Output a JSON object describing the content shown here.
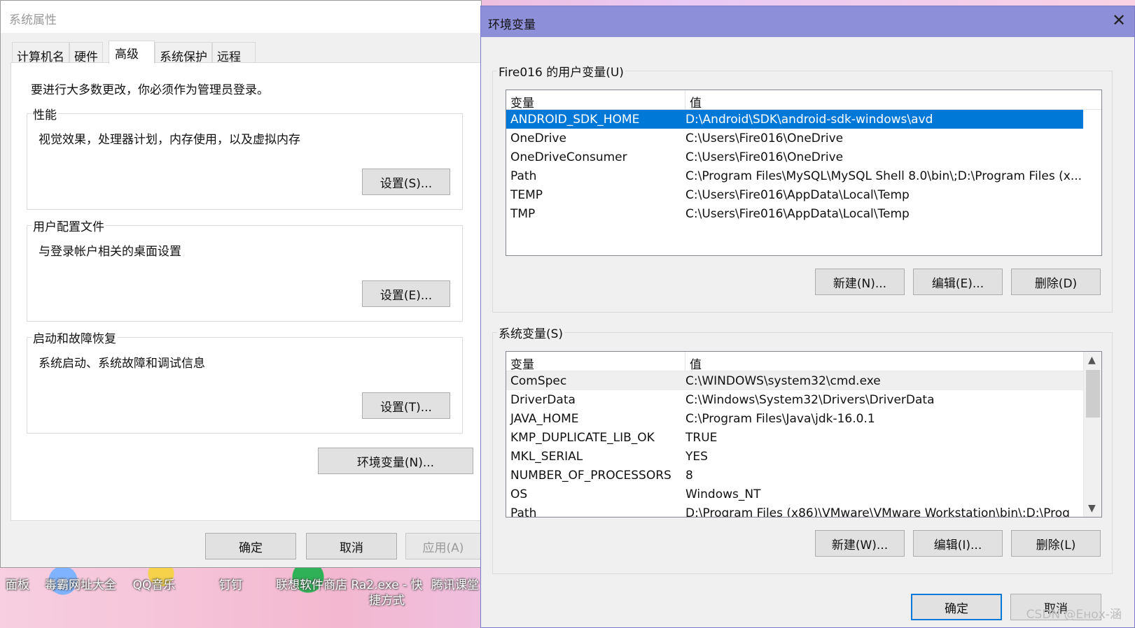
{
  "desktop": {
    "icons": [
      "面板",
      "毒霸网址大全",
      "QQ音乐",
      "钉钉",
      "联想软件商店",
      "Ra2.exe - 快\n捷方式",
      "腾讯课堂"
    ]
  },
  "sysprops": {
    "title": "系统属性",
    "tabs": [
      "计算机名",
      "硬件",
      "高级",
      "系统保护",
      "远程"
    ],
    "active_tab": "高级",
    "admin_note": "要进行大多数更改，你必须作为管理员登录。",
    "performance": {
      "label": "性能",
      "desc": "视觉效果，处理器计划，内存使用，以及虚拟内存",
      "button": "设置(S)..."
    },
    "user_profile": {
      "label": "用户配置文件",
      "desc": "与登录帐户相关的桌面设置",
      "button": "设置(E)..."
    },
    "startup": {
      "label": "启动和故障恢复",
      "desc": "系统启动、系统故障和调试信息",
      "button": "设置(T)..."
    },
    "env_button": "环境变量(N)...",
    "ok": "确定",
    "cancel": "取消",
    "apply": "应用(A)"
  },
  "envvars": {
    "title": "环境变量",
    "close": "✕",
    "user_section_label": "Fire016 的用户变量(U)",
    "col_var": "变量",
    "col_val": "值",
    "user_vars": [
      {
        "name": "ANDROID_SDK_HOME",
        "value": "D:\\Android\\SDK\\android-sdk-windows\\avd"
      },
      {
        "name": "OneDrive",
        "value": "C:\\Users\\Fire016\\OneDrive"
      },
      {
        "name": "OneDriveConsumer",
        "value": "C:\\Users\\Fire016\\OneDrive"
      },
      {
        "name": "Path",
        "value": "C:\\Program Files\\MySQL\\MySQL Shell 8.0\\bin\\;D:\\Program Files (x..."
      },
      {
        "name": "TEMP",
        "value": "C:\\Users\\Fire016\\AppData\\Local\\Temp"
      },
      {
        "name": "TMP",
        "value": "C:\\Users\\Fire016\\AppData\\Local\\Temp"
      }
    ],
    "user_buttons": {
      "new": "新建(N)...",
      "edit": "编辑(E)...",
      "delete": "删除(D)"
    },
    "system_section_label": "系统变量(S)",
    "system_vars": [
      {
        "name": "ComSpec",
        "value": "C:\\WINDOWS\\system32\\cmd.exe"
      },
      {
        "name": "DriverData",
        "value": "C:\\Windows\\System32\\Drivers\\DriverData"
      },
      {
        "name": "JAVA_HOME",
        "value": "C:\\Program Files\\Java\\jdk-16.0.1"
      },
      {
        "name": "KMP_DUPLICATE_LIB_OK",
        "value": "TRUE"
      },
      {
        "name": "MKL_SERIAL",
        "value": "YES"
      },
      {
        "name": "NUMBER_OF_PROCESSORS",
        "value": "8"
      },
      {
        "name": "OS",
        "value": "Windows_NT"
      },
      {
        "name": "Path",
        "value": "D:\\Program Files (x86)\\VMware\\VMware Workstation\\bin\\;D:\\Prog"
      }
    ],
    "system_buttons": {
      "new": "新建(W)...",
      "edit": "编辑(I)...",
      "delete": "删除(L)"
    },
    "ok": "确定",
    "cancel": "取消",
    "watermark": "CSDN @Eнох-涵"
  },
  "colors": {
    "selection": "#0078d7",
    "env_titlebar": "#8e8fd9",
    "button_face": "#e1e1e1"
  }
}
